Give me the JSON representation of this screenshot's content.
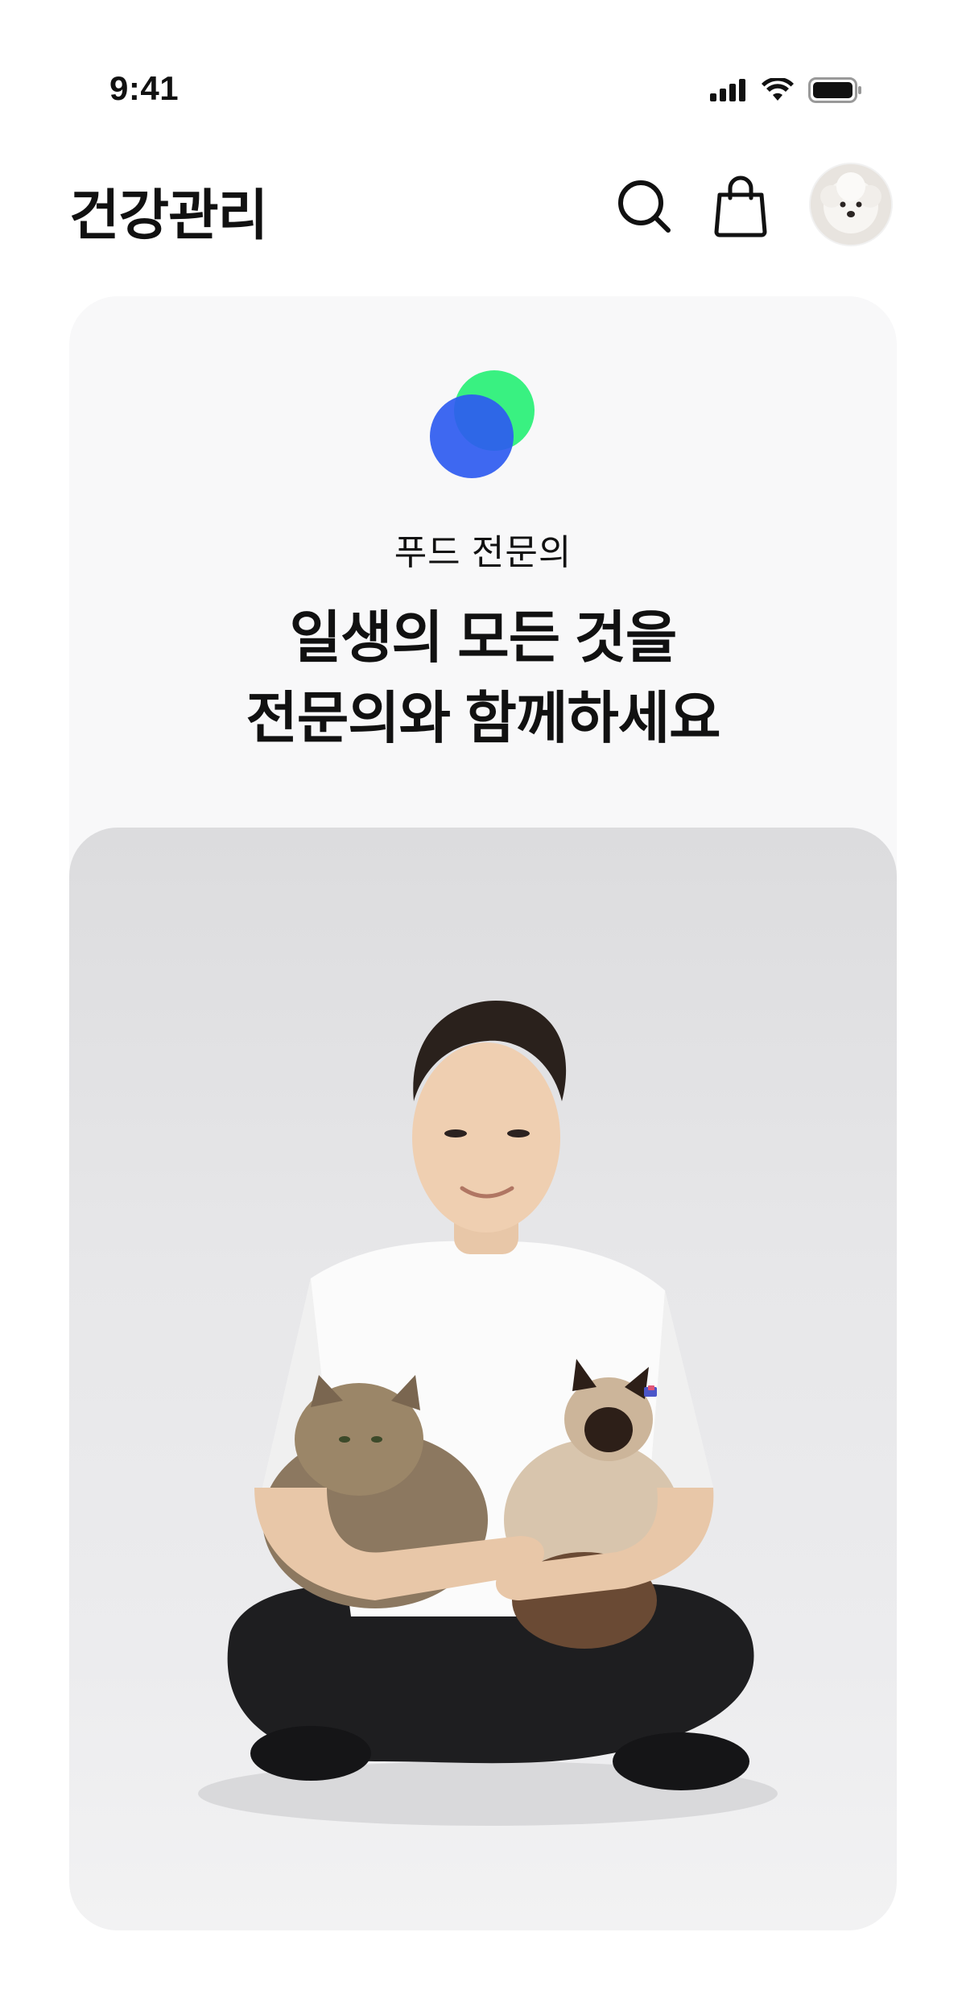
{
  "status_bar": {
    "time": "9:41",
    "icons": [
      "signal-icon",
      "wifi-icon",
      "battery-icon"
    ]
  },
  "header": {
    "title": "건강관리",
    "icons": [
      "search-icon",
      "shopping-bag-icon"
    ],
    "avatar": "dog-avatar"
  },
  "card": {
    "logo": "overlapping-circles-logo",
    "eyebrow": "푸드 전문의",
    "headline_line1": "일생의 모든 것을",
    "headline_line2": "전문의와 함께하세요",
    "image": "man-with-cats-photo"
  },
  "colors": {
    "logo_green": "#2EF07A",
    "logo_blue": "#2E5BF0",
    "card_bg": "#F8F8F9",
    "text": "#111111"
  }
}
